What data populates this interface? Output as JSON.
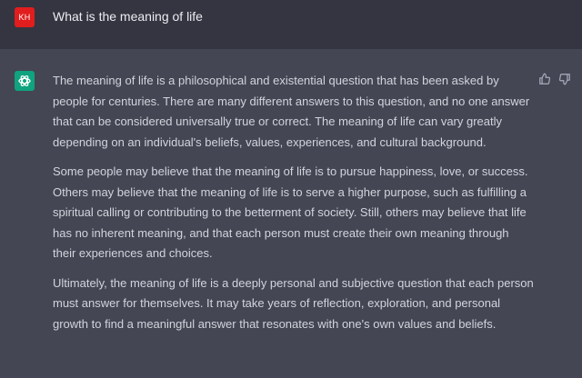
{
  "user": {
    "initials": "KH",
    "message": "What is the meaning of life"
  },
  "assistant": {
    "avatar_icon": "openai-logo-icon",
    "paragraphs": [
      "The meaning of life is a philosophical and existential question that has been asked by people for centuries. There are many different answers to this question, and no one answer that can be considered universally true or correct. The meaning of life can vary greatly depending on an individual's beliefs, values, experiences, and cultural background.",
      "Some people may believe that the meaning of life is to pursue happiness, love, or success. Others may believe that the meaning of life is to serve a higher purpose, such as fulfilling a spiritual calling or contributing to the betterment of society. Still, others may believe that life has no inherent meaning, and that each person must create their own meaning through their experiences and choices.",
      "Ultimately, the meaning of life is a deeply personal and subjective question that each person must answer for themselves. It may take years of reflection, exploration, and personal growth to find a meaningful answer that resonates with one's own values and beliefs."
    ]
  },
  "feedback": {
    "up_icon": "thumbs-up-icon",
    "down_icon": "thumbs-down-icon"
  },
  "colors": {
    "user_row_bg": "#343541",
    "assistant_row_bg": "#444654",
    "user_avatar": "#e21d1d",
    "assistant_avatar": "#10a37f",
    "text": "#d1d5db"
  }
}
